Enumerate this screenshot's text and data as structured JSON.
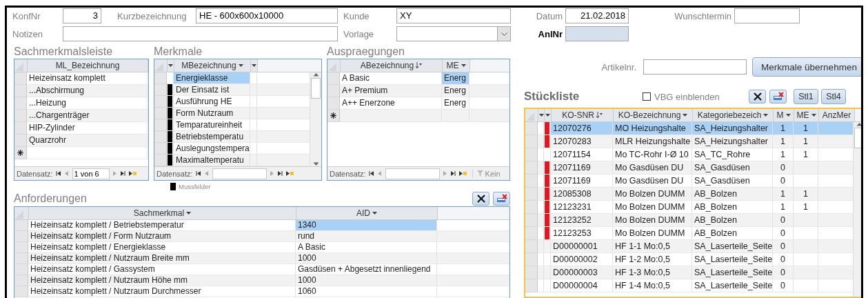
{
  "form": {
    "fields": [
      {
        "label": "KonfNr",
        "value": "3",
        "kind": "number"
      },
      {
        "label": "Kurzbezeichnung",
        "value": "HE - 600x600x10000",
        "kind": "text"
      },
      {
        "label": "Kunde",
        "value": "XY",
        "kind": "text"
      },
      {
        "label": "Datum",
        "value": "21.02.2018",
        "kind": "number"
      },
      {
        "label": "Wunschtermin",
        "kind": "text"
      },
      {
        "label": "Notizen",
        "kind": "text"
      },
      {
        "label": "Vorlage",
        "kind": "combo"
      },
      {
        "label": "AnlNr",
        "kind": "key"
      }
    ]
  },
  "sachmerkmalsleiste": {
    "title": "Sachmerkmalsleiste",
    "new_row": true,
    "columns": [
      {
        "label": "ML_Bezeichnung"
      }
    ],
    "rows": [
      {
        "cells": [
          "Heizeinsatz komplett"
        ],
        "selected": false
      },
      {
        "cells": [
          "...Abschirmung"
        ],
        "selected": false
      },
      {
        "cells": [
          "...Heizung"
        ],
        "selected": false
      },
      {
        "cells": [
          "...Chargenträger"
        ],
        "selected": false
      },
      {
        "cells": [
          "HIP-Zylinder"
        ],
        "selected": false
      },
      {
        "cells": [
          "Quarzrohr"
        ],
        "selected": false
      }
    ],
    "navigator": {
      "label": "Datensatz:",
      "position": "1 von 6"
    }
  },
  "merkmale": {
    "title": "Merkmale",
    "scrollbar": true,
    "marker_column": {
      "menu": true
    },
    "stub_column": {
      "menu": true
    },
    "columns": [
      {
        "label": "MBezeichnung",
        "menu": true,
        "current": true
      }
    ],
    "rows": [
      {
        "cells": [
          "Energieklasse"
        ],
        "selected": true,
        "required": false
      },
      {
        "cells": [
          "Der Einsatz ist"
        ],
        "selected": false,
        "required": true
      },
      {
        "cells": [
          "Ausführung HE"
        ],
        "selected": false,
        "required": true
      },
      {
        "cells": [
          "Form  Nutzraum"
        ],
        "selected": false,
        "required": true
      },
      {
        "cells": [
          "Temparatureinheit"
        ],
        "selected": false,
        "required": true
      },
      {
        "cells": [
          "Betriebstemperatu"
        ],
        "selected": false,
        "required": true
      },
      {
        "cells": [
          "Auslegungstempera"
        ],
        "selected": false,
        "required": true
      },
      {
        "cells": [
          "Maximaltemperatu"
        ],
        "selected": false,
        "required": true
      }
    ],
    "navigator": {
      "label": "Datensatz:"
    }
  },
  "mussfelder_legend": "Mussfelder",
  "auspraegungen": {
    "title": "Auspraegungen",
    "new_row": true,
    "columns": [
      {
        "label": "ABezeichnung",
        "sorted": true
      },
      {
        "label": "ME",
        "menu": true,
        "current": true
      }
    ],
    "rows": [
      {
        "cells": [
          "A  Basic",
          "Energ"
        ],
        "selected": true
      },
      {
        "cells": [
          "A+ Premium",
          "Energ"
        ],
        "selected": false
      },
      {
        "cells": [
          "A++ Enerzone",
          "Energ"
        ],
        "selected": false
      }
    ],
    "navigator": {
      "label": "Datensatz:",
      "filter": "Kein"
    }
  },
  "anforderungen": {
    "title": "Anforderungen",
    "columns": [
      {
        "label": "Sachmerkmal",
        "menu": true
      },
      {
        "label": "AID",
        "menu": true,
        "current": true
      }
    ],
    "rows": [
      {
        "cells": [
          "Heizeinsatz komplett / Betriebstemperatur",
          "1340"
        ],
        "selected": true
      },
      {
        "cells": [
          "Heizeinsatz komplett / Form  Nutzraum",
          "rund"
        ],
        "selected": false
      },
      {
        "cells": [
          "Heizeinsatz komplett / Energieklasse",
          "A  Basic"
        ],
        "selected": false
      },
      {
        "cells": [
          "Heizeinsatz komplett / Nutzraum Breite mm",
          "1000"
        ],
        "selected": false
      },
      {
        "cells": [
          "Heizeinsatz komplett / Gassystem",
          "Gasdüsen + Abgesetzt innenliegend"
        ],
        "selected": false
      },
      {
        "cells": [
          "Heizeinsatz komplett / Nutzraum Höhe mm",
          "1000"
        ],
        "selected": false
      },
      {
        "cells": [
          "Heizeinsatz komplett / Nutzraum Durchmesser",
          "1060"
        ],
        "selected": false
      }
    ]
  },
  "artikel": {
    "label": "Artikelnr.",
    "button": "Merkmale übernehmen"
  },
  "stueckliste": {
    "title": "Stückliste",
    "focused": true,
    "scrollbar": true,
    "vbg": {
      "label": "VBG einblenden",
      "checked": false
    },
    "buttons": [
      "Stl1",
      "Stl4"
    ],
    "blank_column": {
      "menu": true
    },
    "marker_column": {
      "menu": true
    },
    "columns": [
      {
        "label": "KO-SNR",
        "sorted": true
      },
      {
        "label": "KO-Bezeichnung",
        "menu": true
      },
      {
        "label": "Kategoriebezeich",
        "menu": true
      },
      {
        "label": "M",
        "menu": true,
        "kind": "number"
      },
      {
        "label": "ME",
        "menu": true,
        "kind": "number"
      },
      {
        "label": "AnzMer"
      }
    ],
    "rows": [
      {
        "cells": [
          "12070276",
          "MO Heizungshalte",
          "SA_Heizungshalter",
          "1",
          "1"
        ],
        "selected": true,
        "flagged": true
      },
      {
        "cells": [
          "12070283",
          "MLR Heizungshalte",
          "SA_Heizungshalter",
          "1",
          "1"
        ],
        "selected": false,
        "flagged": true
      },
      {
        "cells": [
          "12071154",
          "Mo TC-Rohr  I-Ø 10",
          "SA_TC_Rohre",
          "1",
          "1"
        ],
        "selected": false,
        "flagged": false
      },
      {
        "cells": [
          "12071169",
          "Mo Gasdüsen DU",
          "SA_Gasdüsen",
          "0"
        ],
        "selected": false,
        "flagged": true
      },
      {
        "cells": [
          "12071169",
          "Mo Gasdüsen DU",
          "SA_Gasdüsen",
          "0"
        ],
        "selected": false,
        "flagged": true
      },
      {
        "cells": [
          "12085308",
          "Mo Bolzen DUMM",
          "AB_Bolzen",
          "1",
          "1"
        ],
        "selected": false,
        "flagged": true
      },
      {
        "cells": [
          "12123231",
          "Mo Bolzen DUMM",
          "AB_Bolzen",
          "1",
          "1"
        ],
        "selected": false,
        "flagged": true
      },
      {
        "cells": [
          "12123252",
          "Mo Bolzen DUMM",
          "AB_Bolzen",
          "0"
        ],
        "selected": false,
        "flagged": true
      },
      {
        "cells": [
          "12123253",
          "Mo Bolzen DUMM",
          "AB_Bolzen",
          "0"
        ],
        "selected": false,
        "flagged": true
      },
      {
        "cells": [
          "D00000001",
          "HF 1-1 Mo:0,5",
          "SA_Laserteile_Seite",
          "0"
        ],
        "selected": false,
        "flagged": false
      },
      {
        "cells": [
          "D00000002",
          "HF 1-2 Mo:0,5",
          "SA_Laserteile_Seite",
          "0"
        ],
        "selected": false,
        "flagged": false
      },
      {
        "cells": [
          "D00000003",
          "HF 1-3 Mo:0,5",
          "SA_Laserteile_Seite",
          "0"
        ],
        "selected": false,
        "flagged": false
      },
      {
        "cells": [
          "D00000004",
          "HF 1-4 Mo:0,5",
          "SA_Laserteile_Seite",
          "0"
        ],
        "selected": false,
        "flagged": false
      }
    ]
  }
}
